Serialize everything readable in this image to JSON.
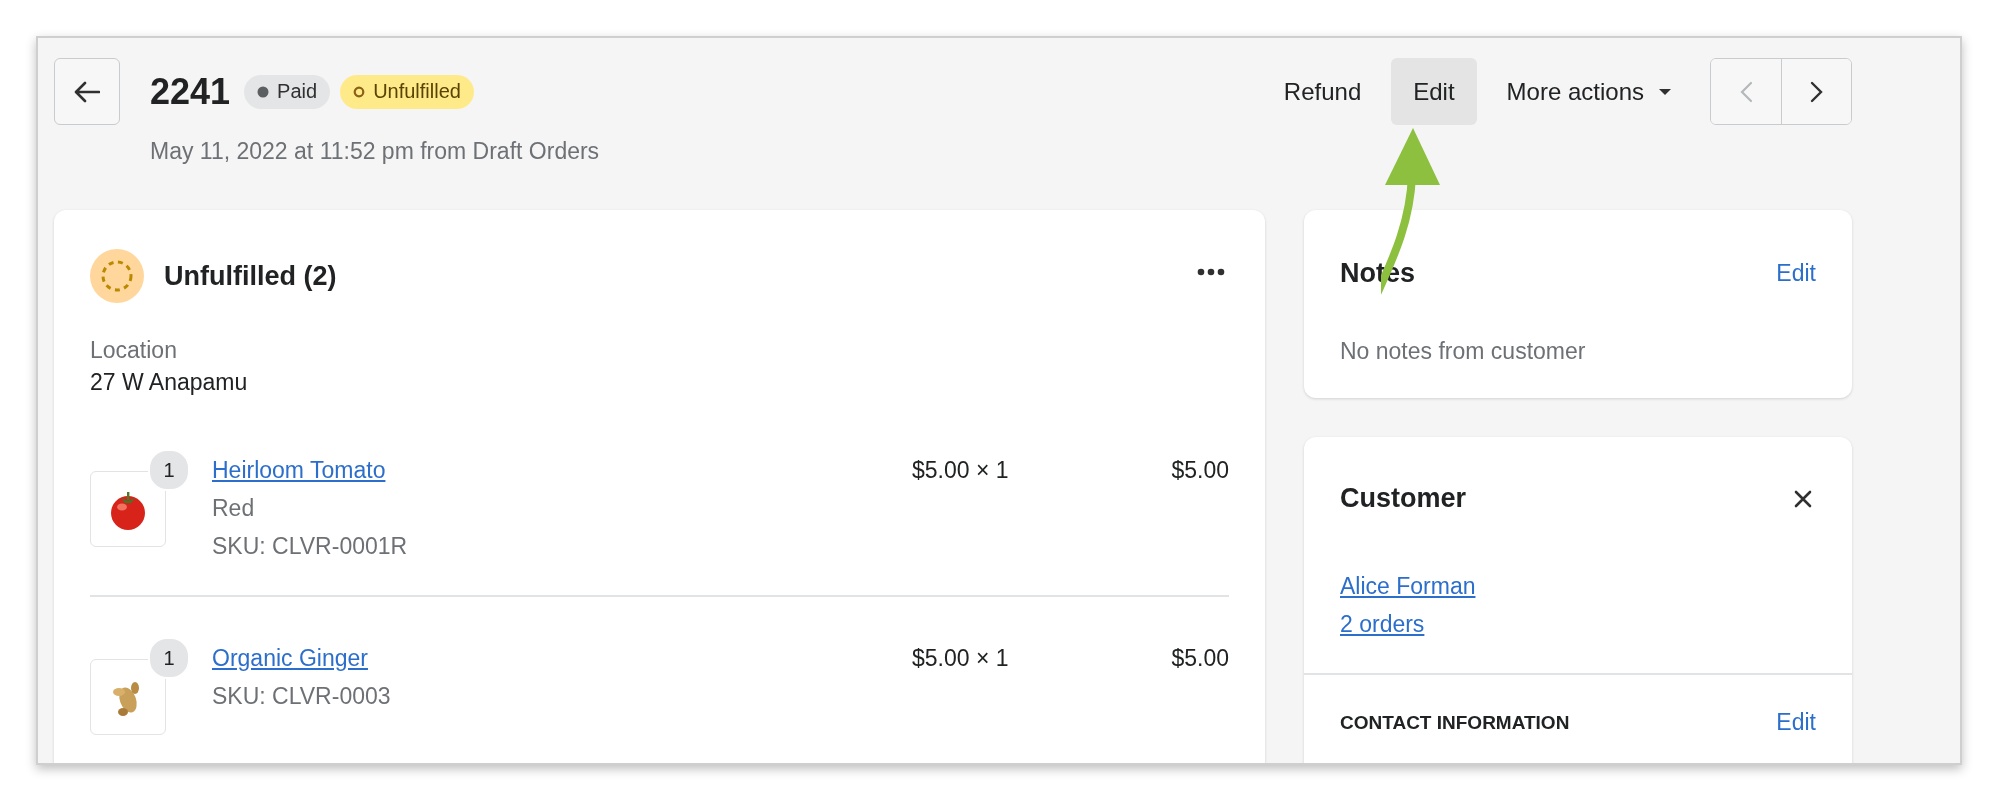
{
  "header": {
    "order_number": "2241",
    "badges": [
      {
        "label": "Paid",
        "kind": "payment"
      },
      {
        "label": "Unfulfilled",
        "kind": "fulfillment"
      }
    ],
    "subtitle": "May 11, 2022 at 11:52 pm from Draft Orders",
    "actions": [
      {
        "label": "Refund",
        "highlighted": false
      },
      {
        "label": "Edit",
        "highlighted": true
      }
    ],
    "more_actions": "More actions"
  },
  "fulfillment_card": {
    "title": "Unfulfilled (2)",
    "location_label": "Location",
    "location": "27 W Anapamu",
    "items": [
      {
        "quantity_badge": "1",
        "name": "Heirloom Tomato",
        "details": [
          "Red",
          "SKU: CLVR-0001R"
        ],
        "unit_price": "$5.00 × 1",
        "total": "$5.00",
        "kind": "tomato"
      },
      {
        "quantity_badge": "1",
        "name": "Organic Ginger",
        "details": [
          "SKU: CLVR-0003"
        ],
        "unit_price": "$5.00 × 1",
        "total": "$5.00",
        "kind": "ginger"
      }
    ]
  },
  "notes_card": {
    "title": "Notes",
    "action": "Edit",
    "text": "No notes from customer"
  },
  "customer_card": {
    "title": "Customer",
    "customer_name": "Alice Forman",
    "orders_link": "2 orders",
    "section_title": "CONTACT INFORMATION",
    "section_action": "Edit"
  }
}
